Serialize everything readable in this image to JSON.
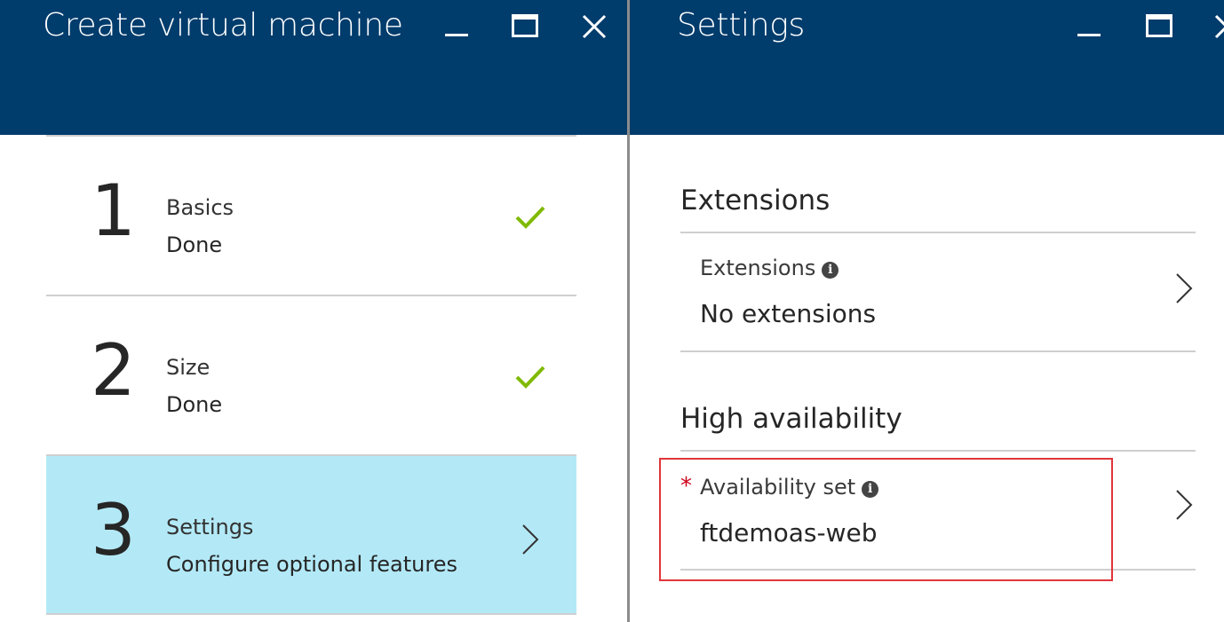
{
  "create_vm": {
    "title": "Create virtual machine",
    "steps": [
      {
        "number": "1",
        "title": "Basics",
        "status": "Done",
        "state": "done"
      },
      {
        "number": "2",
        "title": "Size",
        "status": "Done",
        "state": "done"
      },
      {
        "number": "3",
        "title": "Settings",
        "status": "Configure optional features",
        "state": "active"
      }
    ]
  },
  "settings": {
    "title": "Settings",
    "extensions_section": {
      "heading": "Extensions",
      "field_label": "Extensions",
      "field_value": "No extensions"
    },
    "ha_section": {
      "heading": "High availability",
      "required_mark": "*",
      "field_label": "Availability set",
      "field_value": "ftdemoas-web"
    }
  },
  "icons": {
    "minimize": "minimize-icon",
    "maximize": "maximize-icon",
    "close": "close-icon",
    "check": "checkmark-icon",
    "chevron": "chevron-right-icon",
    "info": "info-icon"
  },
  "colors": {
    "header_bg": "#003c6c",
    "active_step_bg": "#b3e9f7",
    "check_green": "#7fba00",
    "required_red": "#d0021b",
    "highlight_border": "#e0353b"
  }
}
